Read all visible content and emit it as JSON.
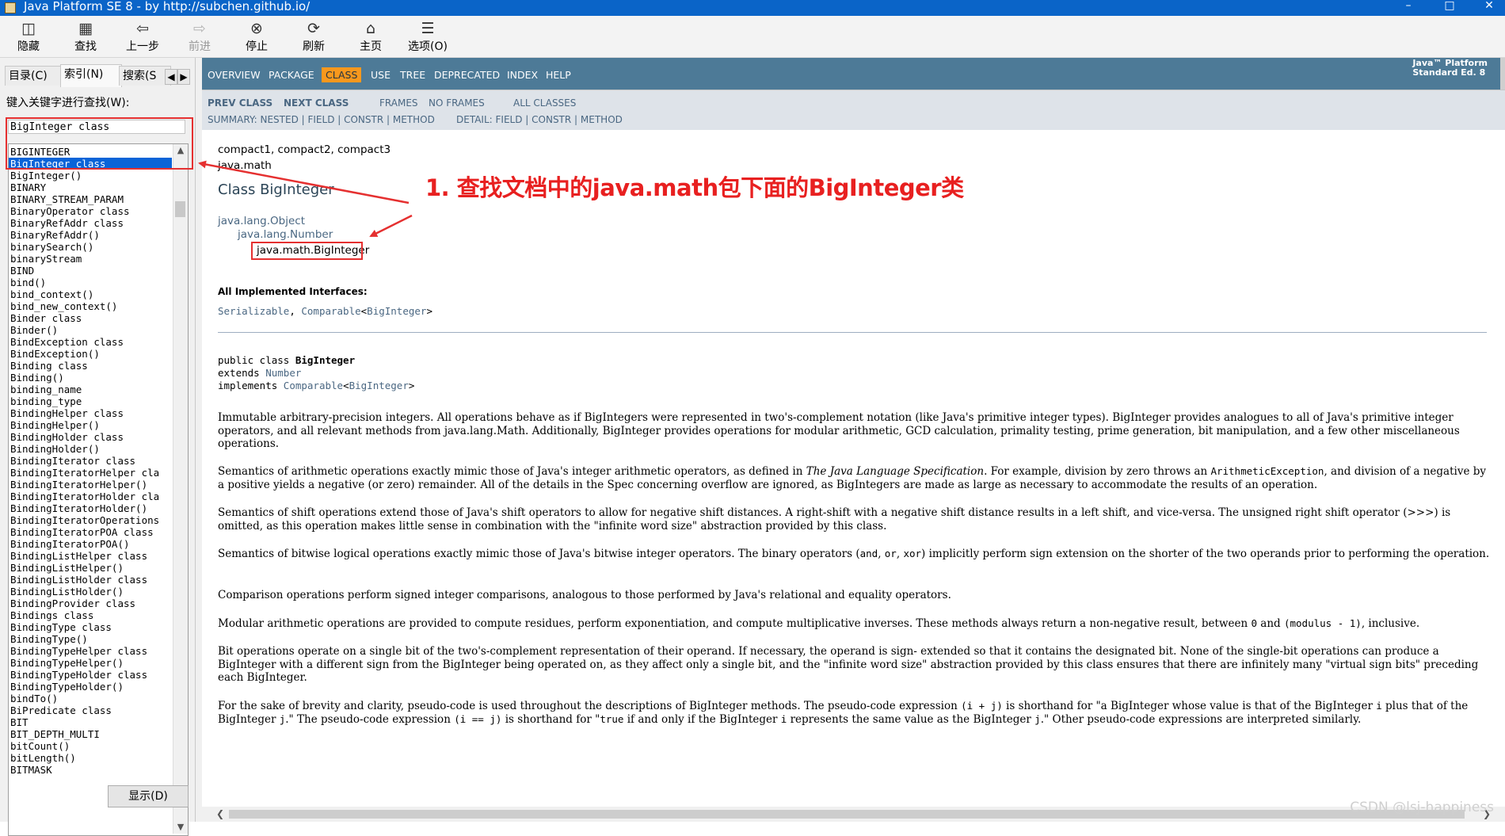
{
  "window": {
    "title": "Java Platform SE 8 - by http://subchen.github.io/",
    "icon": "chm-book-icon",
    "controls": [
      "–",
      "□",
      "✕"
    ]
  },
  "toolbar": {
    "items": [
      {
        "label": "隐藏",
        "icon": "hide-pane-icon",
        "glyph": "◫",
        "enabled": true
      },
      {
        "label": "查找",
        "icon": "find-icon",
        "glyph": "▦",
        "enabled": true
      },
      {
        "label": "上一步",
        "icon": "back-arrow-icon",
        "glyph": "⇦",
        "enabled": true
      },
      {
        "label": "前进",
        "icon": "forward-arrow-icon",
        "glyph": "⇨",
        "enabled": false
      },
      {
        "label": "停止",
        "icon": "stop-icon",
        "glyph": "⊗",
        "enabled": true
      },
      {
        "label": "刷新",
        "icon": "refresh-icon",
        "glyph": "⟳",
        "enabled": true
      },
      {
        "label": "主页",
        "icon": "home-icon",
        "glyph": "⌂",
        "enabled": true
      },
      {
        "label": "选项(O)",
        "icon": "options-icon",
        "glyph": "☰",
        "enabled": true
      }
    ]
  },
  "leftpane": {
    "tabs": {
      "contents": "目录(C)",
      "index": "索引(N)",
      "search": "搜索(S"
    },
    "prompt": "键入关键字进行查找(W):",
    "keyword": "BigInteger class",
    "items": [
      "BIGINTEGER",
      "BigInteger class",
      "BigInteger()",
      "BINARY",
      "BINARY_STREAM_PARAM",
      "BinaryOperator class",
      "BinaryRefAddr class",
      "BinaryRefAddr()",
      "binarySearch()",
      "binaryStream",
      "BIND",
      "bind()",
      "bind_context()",
      "bind_new_context()",
      "Binder class",
      "Binder()",
      "BindException class",
      "BindException()",
      "Binding class",
      "Binding()",
      "binding_name",
      "binding_type",
      "BindingHelper class",
      "BindingHelper()",
      "BindingHolder class",
      "BindingHolder()",
      "BindingIterator class",
      "BindingIteratorHelper cla",
      "BindingIteratorHelper()",
      "BindingIteratorHolder cla",
      "BindingIteratorHolder()",
      "BindingIteratorOperations",
      "BindingIteratorPOA class",
      "BindingIteratorPOA()",
      "BindingListHelper class",
      "BindingListHelper()",
      "BindingListHolder class",
      "BindingListHolder()",
      "BindingProvider class",
      "Bindings class",
      "BindingType class",
      "BindingType()",
      "BindingTypeHelper class",
      "BindingTypeHelper()",
      "BindingTypeHolder class",
      "BindingTypeHolder()",
      "bindTo()",
      "BiPredicate class",
      "BIT",
      "BIT_DEPTH_MULTI",
      "bitCount()",
      "bitLength()",
      "BITMASK"
    ],
    "selected_index": 1,
    "show_button": "显示(D)"
  },
  "javadoc": {
    "nav": [
      "OVERVIEW",
      "PACKAGE",
      "CLASS",
      "USE",
      "TREE",
      "DEPRECATED",
      "INDEX",
      "HELP"
    ],
    "nav_current": "CLASS",
    "platform_line1": "Java™ Platform",
    "platform_line2": "Standard Ed. 8",
    "prev_class": "PREV CLASS",
    "next_class": "NEXT CLASS",
    "frames": "FRAMES",
    "no_frames": "NO FRAMES",
    "all_classes": "ALL CLASSES",
    "summary_label": "SUMMARY: NESTED | ",
    "summary_field": "FIELD",
    "summary_sep1": " | ",
    "summary_constr": "CONSTR",
    "summary_sep2": " | ",
    "summary_method": "METHOD",
    "detail_label": "DETAIL: ",
    "detail_field": "FIELD",
    "detail_sep1": " | ",
    "detail_constr": "CONSTR",
    "detail_sep2": " | ",
    "detail_method": "METHOD",
    "profiles": "compact1, compact2, compact3",
    "package": "java.math",
    "class_title": "Class BigInteger",
    "inheritance": [
      "java.lang.Object",
      "java.lang.Number",
      "java.math.BigInteger"
    ],
    "impl_heading": "All Implemented Interfaces:",
    "impl_serializable": "Serializable",
    "impl_comma": ", ",
    "impl_comparable": "Comparable",
    "impl_lt": "<",
    "impl_biginteger": "BigInteger",
    "impl_gt": ">",
    "decl_public": "public class ",
    "decl_name": "BigInteger",
    "decl_extends": "extends ",
    "decl_number": "Number",
    "decl_implements": "implements ",
    "decl_comparable": "Comparable",
    "decl_lt": "<",
    "decl_bi": "BigInteger",
    "decl_gt": ">",
    "p1": "Immutable arbitrary-precision integers. All operations behave as if BigIntegers were represented in two's-complement notation (like Java's primitive integer types). BigInteger provides analogues to all of Java's primitive integer operators, and all relevant methods from java.lang.Math. Additionally, BigInteger provides operations for modular arithmetic, GCD calculation, primality testing, prime generation, bit manipulation, and a few other miscellaneous operations.",
    "p2a": "Semantics of arithmetic operations exactly mimic those of Java's integer arithmetic operators, as defined in ",
    "p2b": "The Java Language Specification",
    "p2c": ". For example, division by zero throws an ",
    "p2d": "ArithmeticException",
    "p2e": ", and division of a negative by a positive yields a negative (or zero) remainder. All of the details in the Spec concerning overflow are ignored, as BigIntegers are made as large as necessary to accommodate the results of an operation.",
    "p3": "Semantics of shift operations extend those of Java's shift operators to allow for negative shift distances. A right-shift with a negative shift distance results in a left shift, and vice-versa. The unsigned right shift operator (>>>) is omitted, as this operation makes little sense in combination with the \"infinite word size\" abstraction provided by this class.",
    "p4a": "Semantics of bitwise logical operations exactly mimic those of Java's bitwise integer operators. The binary operators (",
    "p4b": "and",
    "p4c": ", ",
    "p4d": "or",
    "p4e": ", ",
    "p4f": "xor",
    "p4g": ") implicitly perform sign extension on the shorter of the two operands prior to performing the operation.",
    "p5": "Comparison operations perform signed integer comparisons, analogous to those performed by Java's relational and equality operators.",
    "p6a": "Modular arithmetic operations are provided to compute residues, perform exponentiation, and compute multiplicative inverses. These methods always return a non-negative result, between ",
    "p6b": "0",
    "p6c": " and ",
    "p6d": "(modulus - 1)",
    "p6e": ", inclusive.",
    "p7": "Bit operations operate on a single bit of the two's-complement representation of their operand. If necessary, the operand is sign- extended so that it contains the designated bit. None of the single-bit operations can produce a BigInteger with a different sign from the BigInteger being operated on, as they affect only a single bit, and the \"infinite word size\" abstraction provided by this class ensures that there are infinitely many \"virtual sign bits\" preceding each BigInteger.",
    "p8a": "For the sake of brevity and clarity, pseudo-code is used throughout the descriptions of BigInteger methods. The pseudo-code expression ",
    "p8b": "(i + j)",
    "p8c": " is shorthand for \"a BigInteger whose value is that of the BigInteger ",
    "p8d": "i",
    "p8e": " plus that of the BigInteger ",
    "p8f": "j",
    "p8g": ".\" The pseudo-code expression ",
    "p8h": "(i == j)",
    "p8i": " is shorthand for \"",
    "p8j": "true",
    "p8k": " if and only if the BigInteger ",
    "p8l": "i",
    "p8m": " represents the same value as the BigInteger ",
    "p8n": "j",
    "p8o": ".\" Other pseudo-code expressions are interpreted similarly."
  },
  "annotation": {
    "text": "1. 查找文档中的java.math包下面的BigInteger类",
    "color": "#e82020"
  },
  "watermark": "CSDN @lsj-happiness"
}
